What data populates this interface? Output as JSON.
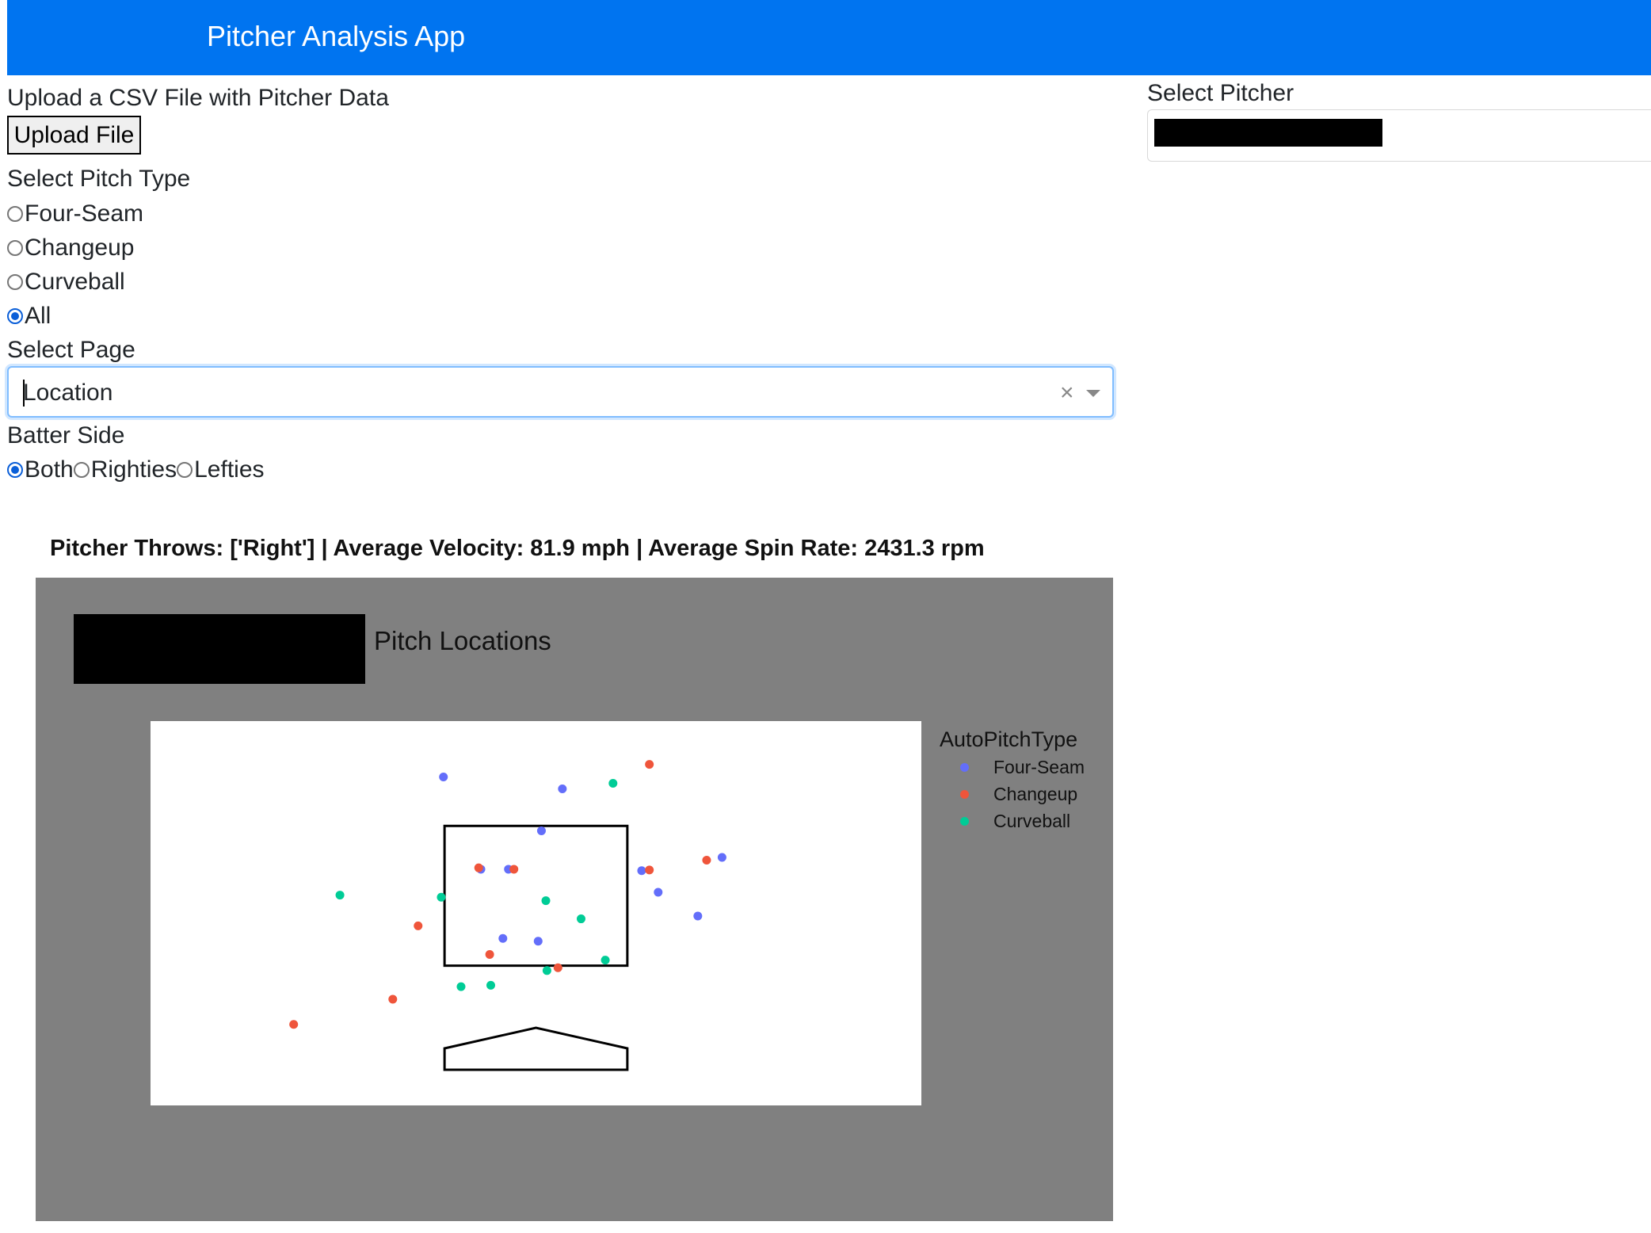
{
  "app": {
    "title": "Pitcher Analysis App"
  },
  "upload": {
    "label": "Upload a CSV File with Pitcher Data",
    "button": "Upload File"
  },
  "pitch_type": {
    "label": "Select Pitch Type",
    "options": [
      "Four-Seam",
      "Changeup",
      "Curveball",
      "All"
    ],
    "selected": "All"
  },
  "page_select": {
    "label": "Select Page",
    "value": "Location",
    "clear_glyph": "×"
  },
  "batter_side": {
    "label": "Batter Side",
    "options": [
      "Both",
      "Righties",
      "Lefties"
    ],
    "selected": "Both"
  },
  "pitcher_select": {
    "label": "Select Pitcher",
    "value_redacted": true
  },
  "stats": {
    "text": "Pitcher Throws: ['Right'] | Average Velocity: 81.9 mph | Average Spin Rate: 2431.3 rpm"
  },
  "chart_data": {
    "type": "scatter",
    "title": "Pitch Locations",
    "title_prefix_redacted": true,
    "legend_title": "AutoPitchType",
    "legend_position": "right",
    "background": "#808080",
    "plot_background": "#ffffff",
    "axes_visible": false,
    "grid": false,
    "strike_zone": {
      "x": [
        -0.83,
        0.83
      ],
      "y": [
        1.5,
        3.5
      ]
    },
    "home_plate": true,
    "xlim": [
      -3.5,
      3.5
    ],
    "ylim": [
      -0.5,
      5.0
    ],
    "series": [
      {
        "name": "Four-Seam",
        "color": "#636efa",
        "x": [
          -0.84,
          0.24,
          0.05,
          -0.5,
          -0.25,
          0.96,
          1.11,
          1.69,
          1.47,
          -0.3,
          0.02
        ],
        "y": [
          4.2,
          4.03,
          3.43,
          2.88,
          2.88,
          2.86,
          2.55,
          3.05,
          2.21,
          1.89,
          1.85
        ]
      },
      {
        "name": "Changeup",
        "color": "#ef553b",
        "x": [
          1.03,
          -0.52,
          -0.2,
          1.03,
          1.55,
          -1.07,
          -0.42,
          0.2,
          -1.3,
          -2.2
        ],
        "y": [
          4.38,
          2.9,
          2.88,
          2.87,
          3.01,
          2.07,
          1.66,
          1.47,
          1.02,
          0.66
        ]
      },
      {
        "name": "Curveball",
        "color": "#00cc96",
        "x": [
          0.7,
          -1.78,
          -0.86,
          0.09,
          0.41,
          0.63,
          0.1,
          -0.68,
          -0.41
        ],
        "y": [
          4.11,
          2.51,
          2.48,
          2.43,
          2.17,
          1.58,
          1.43,
          1.2,
          1.22
        ]
      }
    ]
  }
}
